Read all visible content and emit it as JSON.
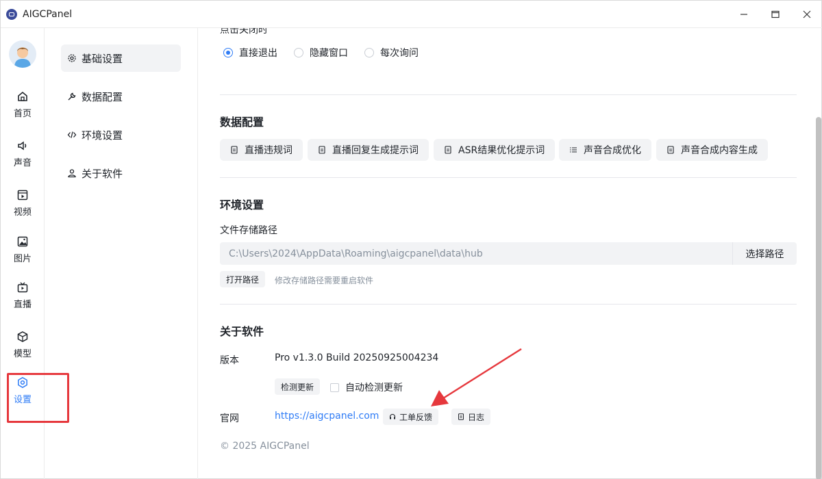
{
  "window": {
    "title": "AIGCPanel"
  },
  "rail": {
    "items": [
      {
        "label": "首页",
        "icon": "home-icon"
      },
      {
        "label": "声音",
        "icon": "sound-icon"
      },
      {
        "label": "视频",
        "icon": "video-icon"
      },
      {
        "label": "图片",
        "icon": "image-icon"
      },
      {
        "label": "直播",
        "icon": "live-icon"
      },
      {
        "label": "模型",
        "icon": "cube-icon"
      },
      {
        "label": "设置",
        "icon": "settings-icon",
        "active": true
      }
    ]
  },
  "subnav": {
    "items": [
      {
        "label": "基础设置",
        "icon": "gear-icon",
        "active": true
      },
      {
        "label": "数据配置",
        "icon": "wrench-icon"
      },
      {
        "label": "环境设置",
        "icon": "code-icon"
      },
      {
        "label": "关于软件",
        "icon": "user-icon"
      }
    ]
  },
  "basic": {
    "close_label": "点击关闭时",
    "options": [
      "直接退出",
      "隐藏窗口",
      "每次询问"
    ],
    "selected": "直接退出"
  },
  "data_config": {
    "title": "数据配置",
    "buttons": [
      "直播违规词",
      "直播回复生成提示词",
      "ASR结果优化提示词",
      "声音合成优化",
      "声音合成内容生成"
    ]
  },
  "env": {
    "title": "环境设置",
    "path_label": "文件存储路径",
    "path_value": "C:\\Users\\2024\\AppData\\Roaming\\aigcpanel\\data\\hub",
    "choose_button": "选择路径",
    "open_button": "打开路径",
    "hint": "修改存储路径需要重启软件"
  },
  "about": {
    "title": "关于软件",
    "version_label": "版本",
    "version_value": "Pro v1.3.0 Build 20250925004234",
    "check_update_button": "检测更新",
    "auto_update_label": "自动检测更新",
    "website_label": "官网",
    "website_url": "https://aigcpanel.com",
    "feedback_button": "工单反馈",
    "log_button": "日志",
    "copyright": "© 2025 AIGCPanel"
  },
  "colors": {
    "accent": "#2f7cf6",
    "annotation": "#e6383d"
  }
}
